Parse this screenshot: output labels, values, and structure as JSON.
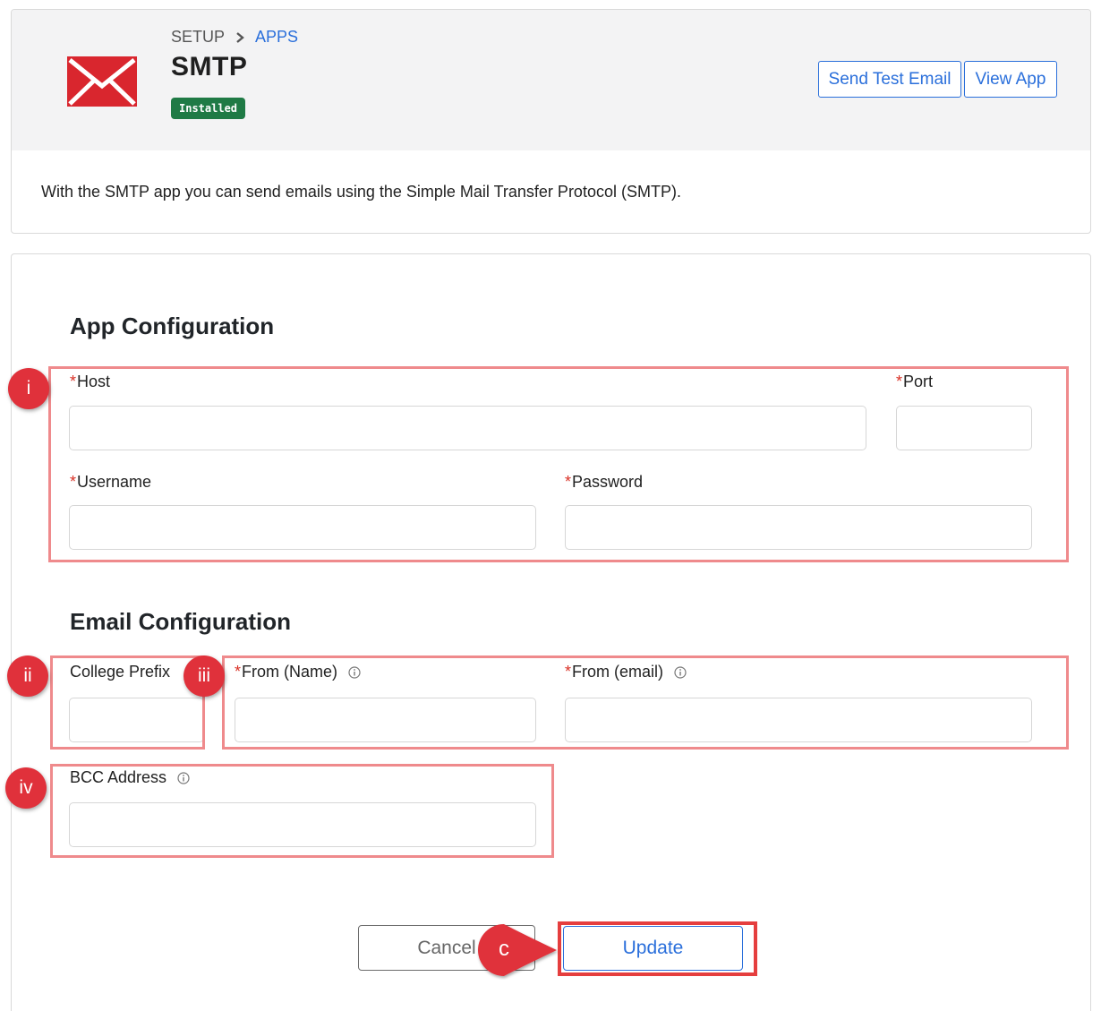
{
  "header": {
    "breadcrumb": {
      "setup": "SETUP",
      "apps": "APPS"
    },
    "title": "SMTP",
    "status_badge": "Installed",
    "send_test_email": "Send Test Email",
    "view_app": "View App",
    "description": "With the SMTP app you can send emails using the Simple Mail Transfer Protocol (SMTP)."
  },
  "app_config": {
    "title": "App Configuration",
    "host_label": "Host",
    "port_label": "Port",
    "username_label": "Username",
    "password_label": "Password",
    "host_value": "",
    "port_value": "",
    "username_value": "",
    "password_value": ""
  },
  "email_config": {
    "title": "Email Configuration",
    "college_prefix_label": "College Prefix",
    "from_name_label": "From (Name)",
    "from_email_label": "From (email)",
    "bcc_label": "BCC Address",
    "college_prefix_value": "",
    "from_name_value": "",
    "from_email_value": "",
    "bcc_value": ""
  },
  "required_marker": "*",
  "actions": {
    "cancel": "Cancel",
    "update": "Update"
  },
  "markers": [
    "i",
    "ii",
    "iii",
    "iv"
  ],
  "callout_label": "c",
  "icons": {
    "logo": "mail-envelope-icon",
    "breadcrumb_separator": "chevron-right-icon",
    "info": "info-circle-icon"
  },
  "colors": {
    "accent": "#2a6fdb",
    "badge": "#1f7a45",
    "required": "#d93025",
    "highlight": "#ef8a8c",
    "marker": "#e0313b",
    "logo": "#d9262e"
  }
}
